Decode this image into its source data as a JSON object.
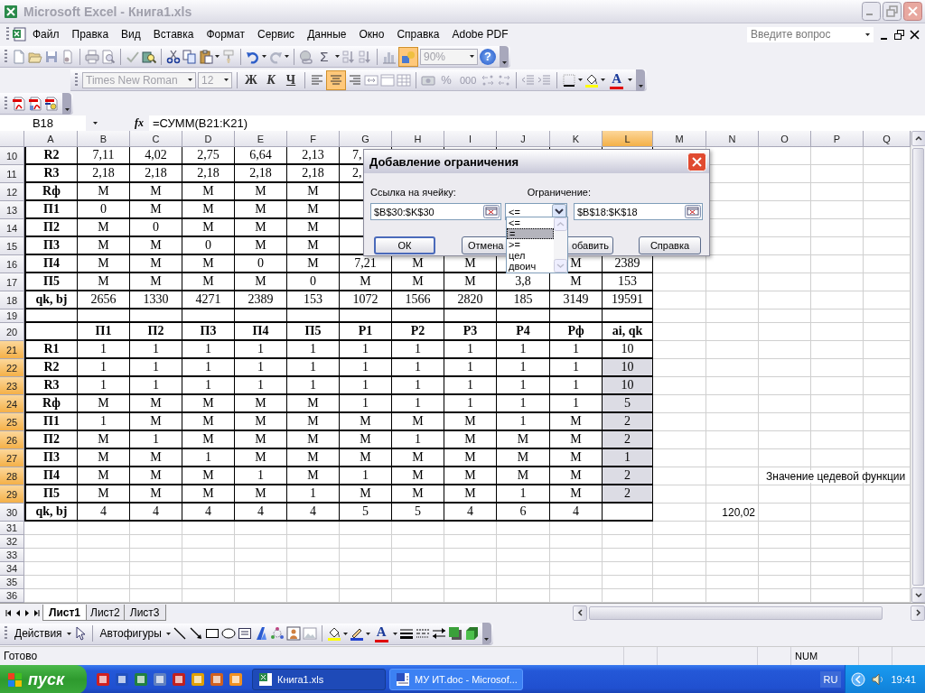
{
  "window": {
    "title": "Microsoft Excel - Книга1.xls"
  },
  "menu": {
    "items": [
      "Файл",
      "Правка",
      "Вид",
      "Вставка",
      "Формат",
      "Сервис",
      "Данные",
      "Окно",
      "Справка",
      "Adobe PDF"
    ],
    "help_placeholder": "Введите вопрос"
  },
  "standard_toolbar": {
    "sum_label": "Σ",
    "zoom": "90%",
    "help_label": "?",
    "drawing_pressed": true
  },
  "formatting_toolbar": {
    "font": "Times New Roman",
    "size": "12",
    "bold_label": "Ж",
    "italic_label": "К",
    "underline_label": "Ч",
    "align_center_pressed": true,
    "percent_label": "%",
    "thousands_label": "000",
    "font_color_label": "A"
  },
  "formula_bar": {
    "name_box": "B18",
    "fx_label": "fx",
    "formula": "=СУММ(B21:K21)"
  },
  "sheet": {
    "columns": [
      {
        "label": "A",
        "selected": false
      },
      {
        "label": "B",
        "selected": false
      },
      {
        "label": "C",
        "selected": false
      },
      {
        "label": "D",
        "selected": false
      },
      {
        "label": "E",
        "selected": false
      },
      {
        "label": "F",
        "selected": false
      },
      {
        "label": "G",
        "selected": false
      },
      {
        "label": "H",
        "selected": false
      },
      {
        "label": "I",
        "selected": false
      },
      {
        "label": "J",
        "selected": false
      },
      {
        "label": "K",
        "selected": false
      },
      {
        "label": "L",
        "selected": true
      },
      {
        "label": "M",
        "selected": false
      },
      {
        "label": "N",
        "selected": false
      },
      {
        "label": "O",
        "selected": false
      },
      {
        "label": "P",
        "selected": false
      },
      {
        "label": "Q",
        "selected": false
      }
    ],
    "rows": [
      {
        "number": "10",
        "kind": "data",
        "selected": false,
        "cells": [
          "R2",
          "7,11",
          "4,02",
          "2,75",
          "6,64",
          "2,13",
          "7,",
          null,
          null,
          null,
          null,
          null
        ]
      },
      {
        "number": "11",
        "kind": "data",
        "selected": false,
        "cells": [
          "R3",
          "2,18",
          "2,18",
          "2,18",
          "2,18",
          "2,18",
          "2,",
          null,
          null,
          null,
          null,
          null
        ]
      },
      {
        "number": "12",
        "kind": "data",
        "selected": false,
        "cells": [
          "Rф",
          "М",
          "М",
          "М",
          "М",
          "М",
          null,
          null,
          null,
          null,
          null,
          null
        ]
      },
      {
        "number": "13",
        "kind": "data",
        "selected": false,
        "cells": [
          "П1",
          "0",
          "М",
          "М",
          "М",
          "М",
          null,
          null,
          null,
          null,
          null,
          null
        ]
      },
      {
        "number": "14",
        "kind": "data",
        "selected": false,
        "cells": [
          "П2",
          "М",
          "0",
          "М",
          "М",
          "М",
          null,
          null,
          null,
          null,
          null,
          null
        ]
      },
      {
        "number": "15",
        "kind": "data",
        "selected": false,
        "cells": [
          "П3",
          "М",
          "М",
          "0",
          "М",
          "М",
          null,
          null,
          null,
          null,
          null,
          null
        ]
      },
      {
        "number": "16",
        "kind": "data",
        "selected": false,
        "cells": [
          "П4",
          "М",
          "М",
          "М",
          "0",
          "М",
          "7,21",
          "М",
          "М",
          null,
          "М",
          "2389"
        ]
      },
      {
        "number": "17",
        "kind": "data",
        "selected": false,
        "cells": [
          "П5",
          "М",
          "М",
          "М",
          "М",
          "0",
          "М",
          "М",
          "М",
          "3,8",
          "М",
          "153"
        ]
      },
      {
        "number": "18",
        "kind": "data",
        "selected": false,
        "cells": [
          "qk, bj",
          "2656",
          "1330",
          "4271",
          "2389",
          "153",
          "1072",
          "1566",
          "2820",
          "185",
          "3149",
          "19591"
        ]
      },
      {
        "number": "19",
        "kind": "spacer",
        "selected": false,
        "cells": []
      },
      {
        "number": "20",
        "kind": "header",
        "selected": false,
        "cells": [
          null,
          "П1",
          "П2",
          "П3",
          "П4",
          "П5",
          "Р1",
          "Р2",
          "Р3",
          "Р4",
          "Рф",
          "ai, qk"
        ]
      },
      {
        "number": "21",
        "kind": "data",
        "selected": true,
        "cells": [
          "R1",
          "1",
          "1",
          "1",
          "1",
          "1",
          "1",
          "1",
          "1",
          "1",
          "1",
          "10"
        ]
      },
      {
        "number": "22",
        "kind": "data",
        "selected": true,
        "cells": [
          "R2",
          "1",
          "1",
          "1",
          "1",
          "1",
          "1",
          "1",
          "1",
          "1",
          "1",
          "10"
        ]
      },
      {
        "number": "23",
        "kind": "data",
        "selected": true,
        "cells": [
          "R3",
          "1",
          "1",
          "1",
          "1",
          "1",
          "1",
          "1",
          "1",
          "1",
          "1",
          "10"
        ]
      },
      {
        "number": "24",
        "kind": "data",
        "selected": true,
        "cells": [
          "Rф",
          "М",
          "М",
          "М",
          "М",
          "М",
          "1",
          "1",
          "1",
          "1",
          "1",
          "5"
        ]
      },
      {
        "number": "25",
        "kind": "data",
        "selected": true,
        "cells": [
          "П1",
          "1",
          "М",
          "М",
          "М",
          "М",
          "М",
          "М",
          "М",
          "1",
          "М",
          "2"
        ]
      },
      {
        "number": "26",
        "kind": "data",
        "selected": true,
        "cells": [
          "П2",
          "М",
          "1",
          "М",
          "М",
          "М",
          "М",
          "1",
          "М",
          "М",
          "М",
          "2"
        ]
      },
      {
        "number": "27",
        "kind": "data",
        "selected": true,
        "cells": [
          "П3",
          "М",
          "М",
          "1",
          "М",
          "М",
          "М",
          "М",
          "М",
          "М",
          "М",
          "1"
        ]
      },
      {
        "number": "28",
        "kind": "data",
        "selected": true,
        "cells": [
          "П4",
          "М",
          "М",
          "М",
          "1",
          "М",
          "1",
          "М",
          "М",
          "М",
          "М",
          "2"
        ],
        "note": "Значение цедевой функции"
      },
      {
        "number": "29",
        "kind": "data",
        "selected": true,
        "cells": [
          "П5",
          "М",
          "М",
          "М",
          "М",
          "1",
          "М",
          "М",
          "М",
          "1",
          "М",
          "2"
        ]
      },
      {
        "number": "30",
        "kind": "data",
        "selected": false,
        "cells": [
          "qk, bj",
          "4",
          "4",
          "4",
          "4",
          "4",
          "5",
          "5",
          "4",
          "6",
          "4",
          null
        ],
        "result": "120,02"
      },
      {
        "number": "31",
        "kind": "blank",
        "selected": false,
        "cells": []
      },
      {
        "number": "32",
        "kind": "blank",
        "selected": false,
        "cells": []
      },
      {
        "number": "33",
        "kind": "blank",
        "selected": false,
        "cells": []
      },
      {
        "number": "34",
        "kind": "blank",
        "selected": false,
        "cells": []
      },
      {
        "number": "35",
        "kind": "blank",
        "selected": false,
        "cells": []
      },
      {
        "number": "36",
        "kind": "blank",
        "selected": false,
        "cells": []
      }
    ]
  },
  "dialog": {
    "title": "Добавление ограничения",
    "cell_ref_label": "Ссылка на ячейку:",
    "cell_ref_value": "$B$30:$K$30",
    "operator_value": "<=",
    "constraint_label": "Ограничение:",
    "constraint_value": "$B$18:$K$18",
    "operator_options": [
      {
        "label": "<=",
        "selected": false
      },
      {
        "label": "=",
        "selected": true
      },
      {
        "label": ">=",
        "selected": false
      },
      {
        "label": "цел",
        "selected": false
      },
      {
        "label": "двоич",
        "selected": false
      }
    ],
    "buttons": [
      {
        "label": "ОК",
        "default": true
      },
      {
        "label": "Отмена",
        "default": false
      },
      {
        "label": "обавить",
        "default": false
      },
      {
        "label": "Справка",
        "default": false
      }
    ]
  },
  "sheet_tabs": [
    {
      "label": "Лист1",
      "selected": true
    },
    {
      "label": "Лист2",
      "selected": false
    },
    {
      "label": "Лист3",
      "selected": false
    }
  ],
  "drawing_toolbar": {
    "actions_label": "Действия",
    "autoshapes_label": "Автофигуры",
    "font_color_label": "A"
  },
  "status_bar": {
    "text": "Готово",
    "num": "NUM"
  },
  "taskbar": {
    "start_label": "пуск",
    "tasks": [
      {
        "label": "Книга1.xls",
        "kind": "spreadsheet",
        "selected": true
      },
      {
        "label": "МУ ИТ.doc - Microsof...",
        "kind": "document",
        "selected": false
      }
    ],
    "language": "RU",
    "time": "19:41"
  }
}
